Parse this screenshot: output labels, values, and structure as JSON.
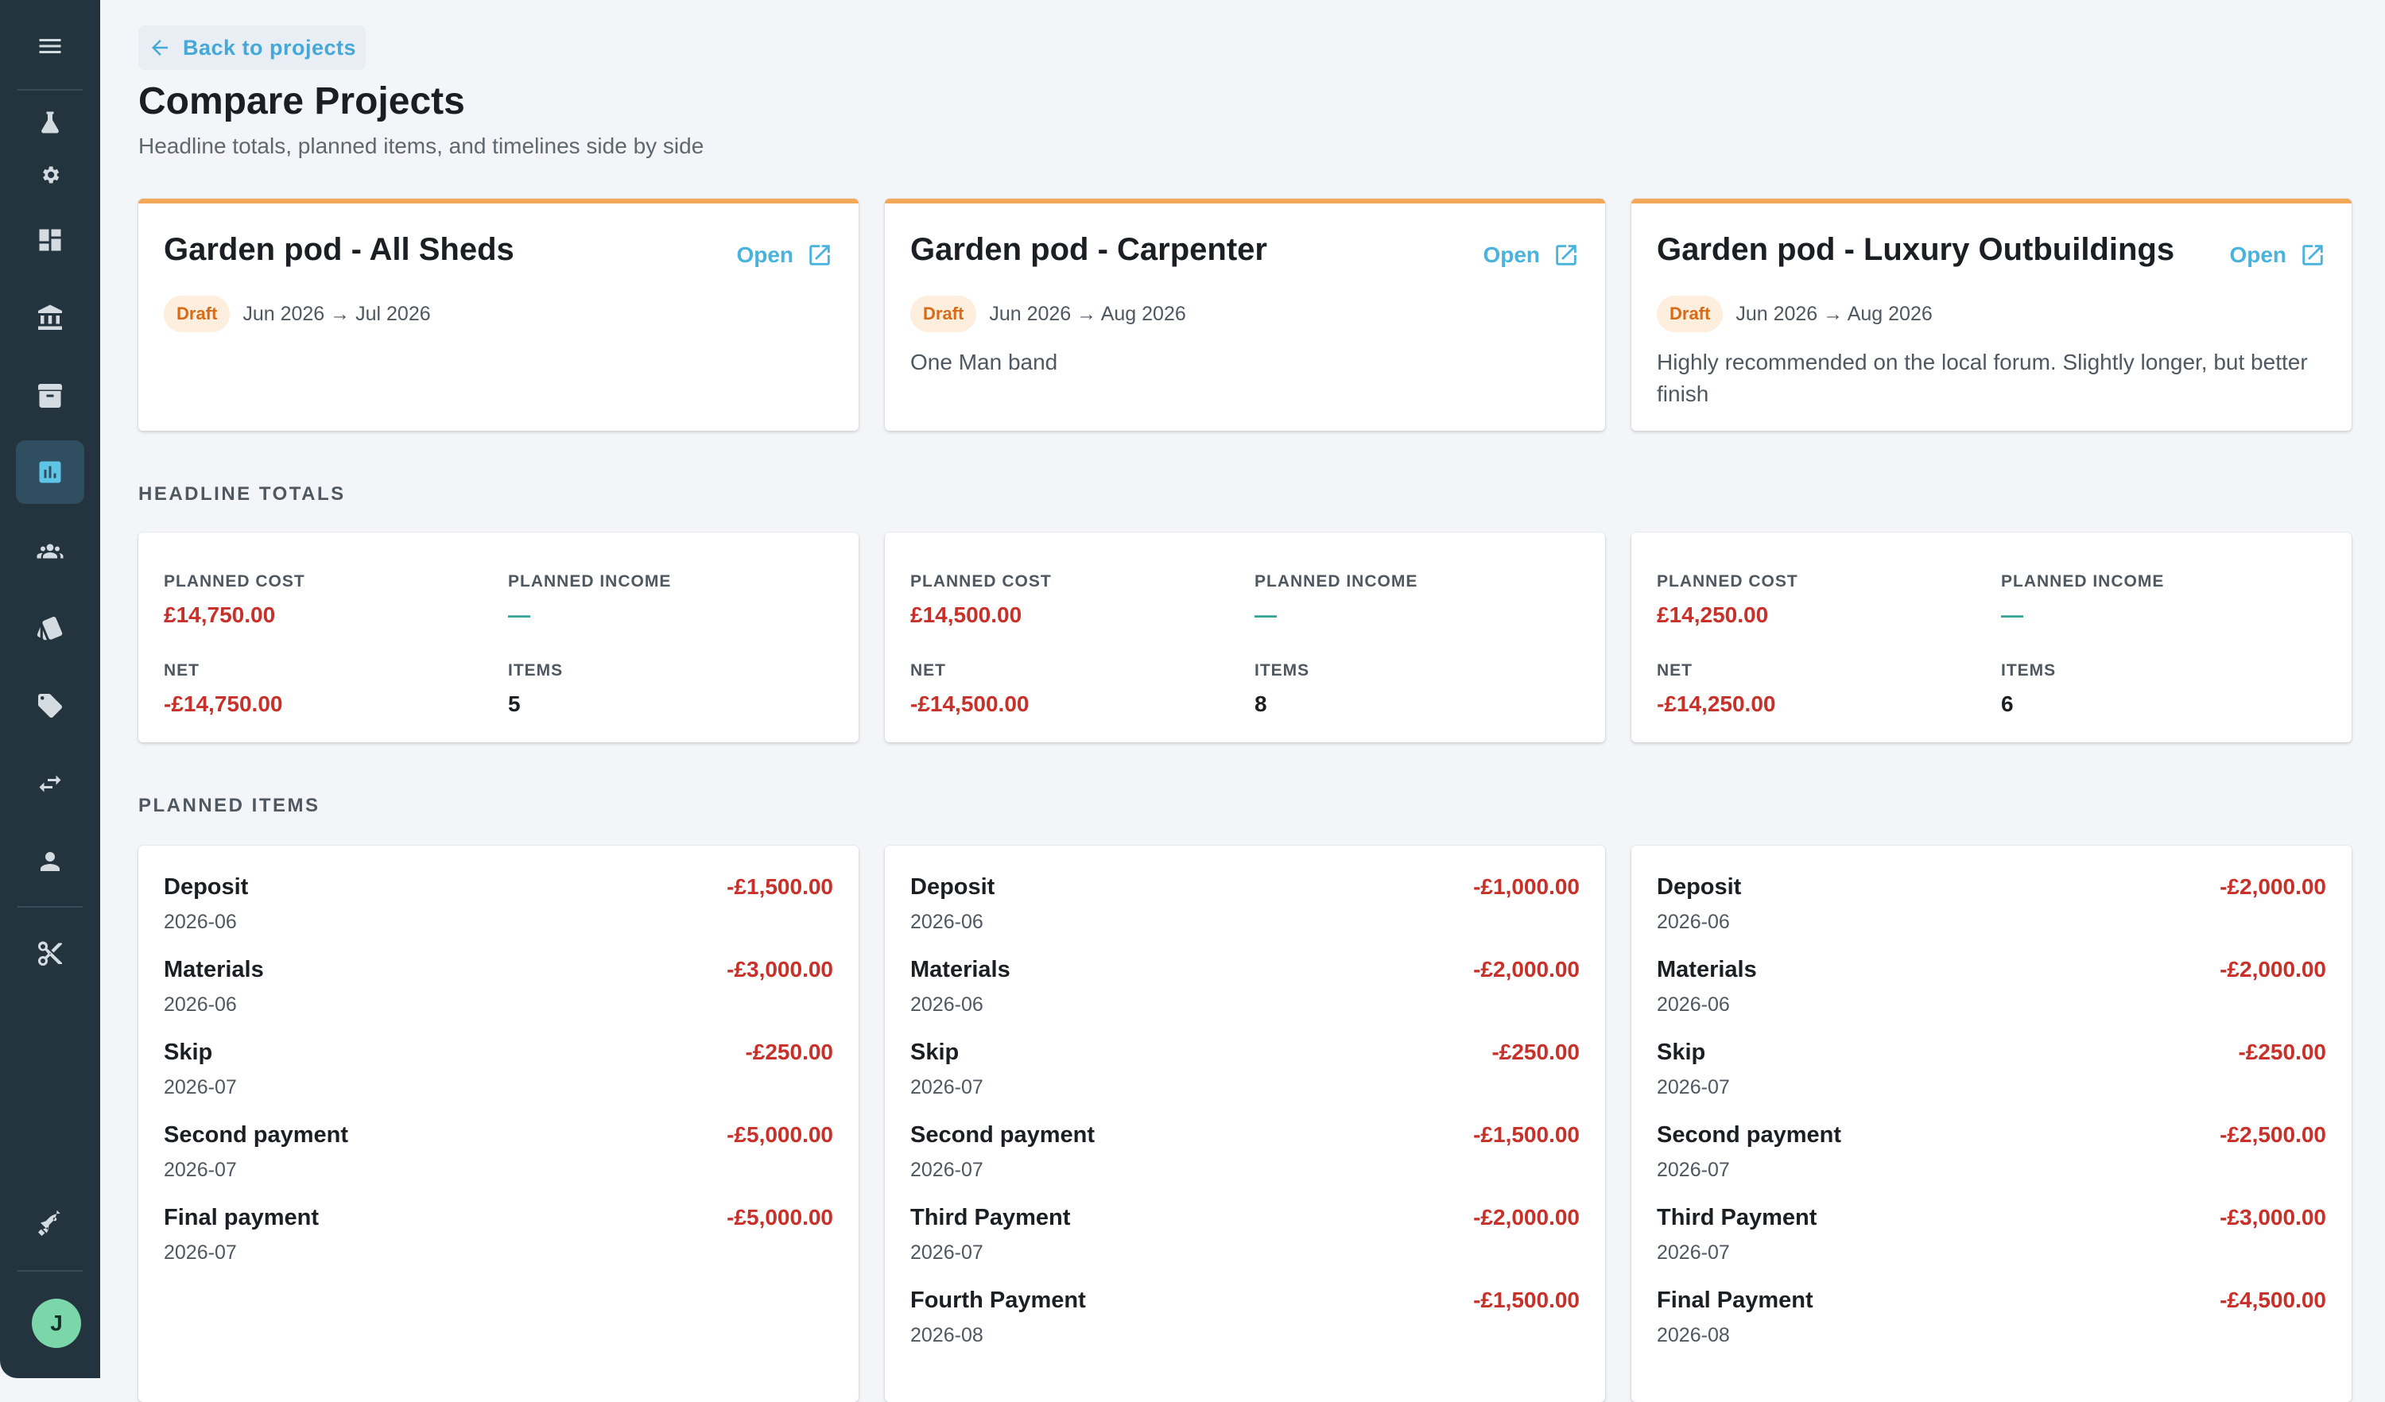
{
  "nav": {
    "icons": [
      "menu-icon",
      "flask-icon",
      "settings-icon",
      "dashboard-icon",
      "bank-icon",
      "archive-icon",
      "chart-icon",
      "people-icon",
      "cards-icon",
      "tag-icon",
      "transfer-icon",
      "person-icon",
      "scissors-icon",
      "rocket-icon"
    ],
    "active": "chart-icon",
    "avatar_initial": "J"
  },
  "header": {
    "back_label": "Back to projects",
    "title": "Compare Projects",
    "subtitle": "Headline totals, planned items, and timelines side by side"
  },
  "sections": {
    "headline_totals": "HEADLINE TOTALS",
    "planned_items": "PLANNED ITEMS"
  },
  "labels": {
    "open": "Open",
    "planned_cost": "PLANNED COST",
    "planned_income": "PLANNED INCOME",
    "net": "NET",
    "items": "ITEMS"
  },
  "colors": {
    "accent": "#4ab3dd",
    "negative": "#c8302a",
    "card_top": "#f2a857",
    "sidebar": "#24343f"
  },
  "projects": [
    {
      "name": "Garden pod - All Sheds",
      "status": "Draft",
      "dates": "Jun 2026 → Jul 2026",
      "description": "",
      "totals": {
        "planned_cost": "£14,750.00",
        "planned_income": "—",
        "net": "-£14,750.00",
        "items": "5"
      },
      "planned_items": [
        {
          "name": "Deposit",
          "date": "2026-06",
          "amount": "-£1,500.00"
        },
        {
          "name": "Materials",
          "date": "2026-06",
          "amount": "-£3,000.00"
        },
        {
          "name": "Skip",
          "date": "2026-07",
          "amount": "-£250.00"
        },
        {
          "name": "Second payment",
          "date": "2026-07",
          "amount": "-£5,000.00"
        },
        {
          "name": "Final payment",
          "date": "2026-07",
          "amount": "-£5,000.00"
        }
      ]
    },
    {
      "name": "Garden pod - Carpenter",
      "status": "Draft",
      "dates": "Jun 2026 → Aug 2026",
      "description": "One Man band",
      "totals": {
        "planned_cost": "£14,500.00",
        "planned_income": "—",
        "net": "-£14,500.00",
        "items": "8"
      },
      "planned_items": [
        {
          "name": "Deposit",
          "date": "2026-06",
          "amount": "-£1,000.00"
        },
        {
          "name": "Materials",
          "date": "2026-06",
          "amount": "-£2,000.00"
        },
        {
          "name": "Skip",
          "date": "2026-07",
          "amount": "-£250.00"
        },
        {
          "name": "Second payment",
          "date": "2026-07",
          "amount": "-£1,500.00"
        },
        {
          "name": "Third Payment",
          "date": "2026-07",
          "amount": "-£2,000.00"
        },
        {
          "name": "Fourth Payment",
          "date": "2026-08",
          "amount": "-£1,500.00"
        }
      ]
    },
    {
      "name": "Garden pod - Luxury Outbuildings",
      "status": "Draft",
      "dates": "Jun 2026 → Aug 2026",
      "description": "Highly recommended on the local forum. Slightly longer, but better finish",
      "totals": {
        "planned_cost": "£14,250.00",
        "planned_income": "—",
        "net": "-£14,250.00",
        "items": "6"
      },
      "planned_items": [
        {
          "name": "Deposit",
          "date": "2026-06",
          "amount": "-£2,000.00"
        },
        {
          "name": "Materials",
          "date": "2026-06",
          "amount": "-£2,000.00"
        },
        {
          "name": "Skip",
          "date": "2026-07",
          "amount": "-£250.00"
        },
        {
          "name": "Second payment",
          "date": "2026-07",
          "amount": "-£2,500.00"
        },
        {
          "name": "Third Payment",
          "date": "2026-07",
          "amount": "-£3,000.00"
        },
        {
          "name": "Final Payment",
          "date": "2026-08",
          "amount": "-£4,500.00"
        }
      ]
    }
  ]
}
